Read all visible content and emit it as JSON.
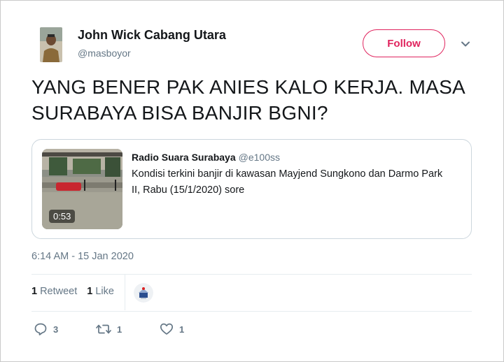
{
  "author": {
    "display_name": "John Wick Cabang Utara",
    "handle": "@masboyor"
  },
  "follow_label": "Follow",
  "tweet_text": "YANG BENER PAK ANIES KALO KERJA. MASA SURABAYA BISA BANJIR BGNI?",
  "quoted": {
    "display_name": "Radio Suara Surabaya",
    "handle": "@e100ss",
    "text": "Kondisi terkini banjir di kawasan Mayjend Sungkono dan Darmo Park II, Rabu (15/1/2020) sore",
    "video_duration": "0:53"
  },
  "timestamp": "6:14 AM - 15 Jan 2020",
  "stats": {
    "retweets_count": "1",
    "retweets_label": "Retweet",
    "likes_count": "1",
    "likes_label": "Like"
  },
  "actions": {
    "reply_count": "3",
    "retweet_count": "1",
    "like_count": "1"
  },
  "colors": {
    "accent": "#e0245e",
    "secondary_text": "#657786",
    "border": "#ccd6dd"
  },
  "icons": [
    "chevron-down-icon",
    "reply-icon",
    "retweet-icon",
    "heart-icon",
    "play-duration-badge"
  ]
}
